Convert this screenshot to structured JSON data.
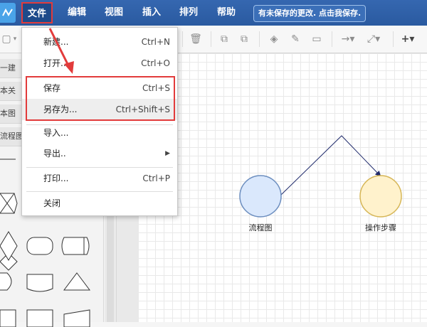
{
  "menubar": {
    "file": "文件",
    "edit": "编辑",
    "view": "视图",
    "insert": "插入",
    "arrange": "排列",
    "help": "帮助",
    "unsaved_notice": "有未保存的更改. 点击我保存."
  },
  "file_menu": {
    "items": [
      {
        "label": "新建...",
        "shortcut": "Ctrl+N"
      },
      {
        "label": "打开...",
        "shortcut": "Ctrl+O"
      },
      {
        "label": "保存",
        "shortcut": "Ctrl+S"
      },
      {
        "label": "另存为...",
        "shortcut": "Ctrl+Shift+S"
      },
      {
        "label": "导入...",
        "shortcut": ""
      },
      {
        "label": "导出..",
        "shortcut": ""
      },
      {
        "label": "打印...",
        "shortcut": "Ctrl+P"
      },
      {
        "label": "关闭",
        "shortcut": ""
      }
    ]
  },
  "left_panel": {
    "categories": [
      "一建",
      "本关",
      "本图",
      "流程图"
    ]
  },
  "canvas": {
    "node1_label": "流程图",
    "node2_label": "操作步骤"
  },
  "colors": {
    "menubar": "#2a5aa0",
    "highlight_red": "#e23b3b",
    "node1_fill": "#dae8fc",
    "node1_stroke": "#6c8ebf",
    "node2_fill": "#fff2cc",
    "node2_stroke": "#d6b656",
    "connector": "#1f2a6b"
  },
  "icons": [
    "logo-icon",
    "undo-icon",
    "redo-icon",
    "delete-icon",
    "to-front-icon",
    "to-back-icon",
    "fill-icon",
    "line-color-icon",
    "shadow-icon",
    "connection-icon",
    "waypoint-icon",
    "add-icon",
    "submenu-arrow-icon"
  ]
}
